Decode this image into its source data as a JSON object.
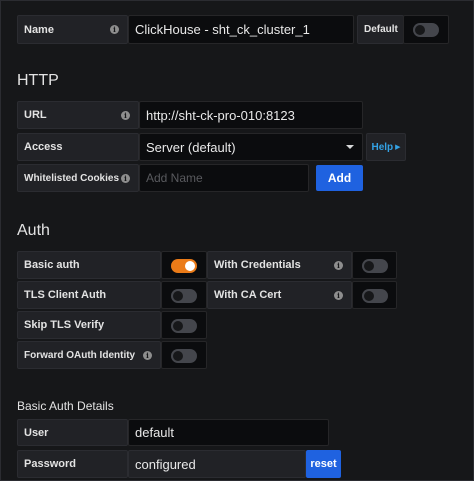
{
  "general": {
    "name_label": "Name",
    "name_value": "ClickHouse - sht_ck_cluster_1",
    "default_label": "Default",
    "default_on": false
  },
  "http": {
    "heading": "HTTP",
    "url_label": "URL",
    "url_value": "http://sht-ck-pro-010:8123",
    "access_label": "Access",
    "access_value": "Server (default)",
    "help_label": "Help",
    "cookies_label": "Whitelisted Cookies",
    "cookies_placeholder": "Add Name",
    "add_label": "Add"
  },
  "auth": {
    "heading": "Auth",
    "basic_auth_label": "Basic auth",
    "basic_auth_on": true,
    "with_credentials_label": "With Credentials",
    "with_credentials_on": false,
    "tls_client_auth_label": "TLS Client Auth",
    "tls_client_auth_on": false,
    "with_ca_cert_label": "With CA Cert",
    "with_ca_cert_on": false,
    "skip_tls_label": "Skip TLS Verify",
    "skip_tls_on": false,
    "forward_oauth_label": "Forward OAuth Identity",
    "forward_oauth_on": false
  },
  "basic_auth_details": {
    "heading": "Basic Auth Details",
    "user_label": "User",
    "user_value": "default",
    "password_label": "Password",
    "password_value": "configured",
    "reset_label": "reset"
  },
  "icons": {
    "info": "info-icon",
    "toggle": "toggle-switch",
    "caret": "caret-down-icon",
    "help_arrow": "caret-right-icon"
  },
  "colors": {
    "background": "#161719",
    "label_bg": "#212226",
    "input_bg": "#0b0c0e",
    "toggle_on": "#eb7b18",
    "primary_button": "#1f62e0",
    "link": "#33a2e5"
  }
}
